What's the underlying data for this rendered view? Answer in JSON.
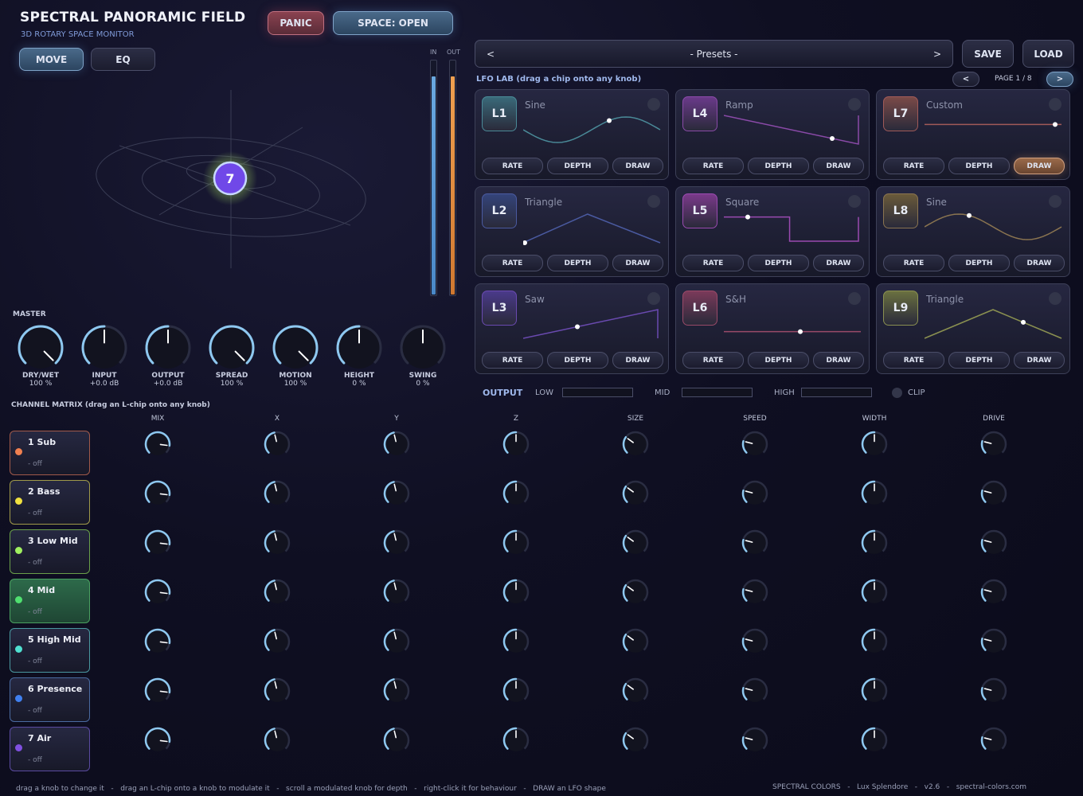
{
  "header": {
    "title": "SPECTRAL PANORAMIC FIELD",
    "subtitle": "3D ROTARY SPACE MONITOR",
    "panic_label": "PANIC",
    "space_label": "SPACE:  OPEN",
    "move_label": "MOVE",
    "eq_label": "EQ"
  },
  "monitor": {
    "source_number": "7"
  },
  "meters": {
    "in_label": "IN",
    "out_label": "OUT",
    "in_level": 0.93,
    "out_level": 0.93
  },
  "presets": {
    "prev": "<",
    "name": "- Presets -",
    "next": ">",
    "save": "SAVE",
    "load": "LOAD"
  },
  "lfo_lab": {
    "title": "LFO LAB  (drag a chip onto any knob)",
    "page": "PAGE 1 / 8",
    "page_prev": "<",
    "page_next": ">",
    "rate_label": "RATE",
    "depth_label": "DEPTH",
    "draw_label": "DRAW",
    "cards": [
      {
        "id": "L1",
        "shape": "Sine"
      },
      {
        "id": "L2",
        "shape": "Triangle"
      },
      {
        "id": "L3",
        "shape": "Saw"
      },
      {
        "id": "L4",
        "shape": "Ramp"
      },
      {
        "id": "L5",
        "shape": "Square"
      },
      {
        "id": "L6",
        "shape": "S&H"
      },
      {
        "id": "L7",
        "shape": "Custom"
      },
      {
        "id": "L8",
        "shape": "Sine"
      },
      {
        "id": "L9",
        "shape": "Triangle"
      }
    ]
  },
  "master": {
    "title": "MASTER",
    "knobs": [
      {
        "label": "DRY/WET",
        "value": "100 %"
      },
      {
        "label": "INPUT",
        "value": "+0.0 dB"
      },
      {
        "label": "OUTPUT",
        "value": "+0.0 dB"
      },
      {
        "label": "SPREAD",
        "value": "100 %"
      },
      {
        "label": "MOTION",
        "value": "100 %"
      },
      {
        "label": "HEIGHT",
        "value": "0 %"
      },
      {
        "label": "SWING",
        "value": "0 %"
      }
    ]
  },
  "output": {
    "label": "OUTPUT",
    "low": "LOW",
    "mid": "MID",
    "high": "HIGH",
    "clip": "CLIP"
  },
  "matrix": {
    "title": "CHANNEL MATRIX  (drag an L-chip onto any knob)",
    "columns": [
      "MIX",
      "X",
      "Y",
      "Z",
      "SIZE",
      "SPEED",
      "WIDTH",
      "DRIVE"
    ],
    "channels": [
      {
        "name": "1 Sub",
        "status": "- off",
        "color": "#f08050"
      },
      {
        "name": "2 Bass",
        "status": "- off",
        "color": "#f0e040"
      },
      {
        "name": "3 Low Mid",
        "status": "- off",
        "color": "#a0f060"
      },
      {
        "name": "4 Mid",
        "status": "- off",
        "color": "#50e070"
      },
      {
        "name": "5 High Mid",
        "status": "- off",
        "color": "#50e0d0"
      },
      {
        "name": "6 Presence",
        "status": "- off",
        "color": "#4080f0"
      },
      {
        "name": "7 Air",
        "status": "- off",
        "color": "#8050e0"
      }
    ]
  },
  "footer": {
    "help": "drag a knob to change it   -   drag an L-chip onto a knob to modulate it   -   scroll a modulated knob for depth   -   right-click it for behaviour   -   DRAW an LFO shape",
    "brand": "SPECTRAL COLORS   -   Lux Splendore   -   v2.6   -   spectral-colors.com"
  },
  "colors": {
    "accent": "#8ec8f0",
    "chip_l1": "#3a6a7a",
    "chip_l2": "#34447a",
    "chip_l3": "#4a3a8a",
    "chip_l4": "#6a3a8a",
    "chip_l5": "#7a3a8a",
    "chip_l6": "#7a3a5a",
    "chip_l7": "#7a4a48",
    "chip_l8": "#6a5a3a",
    "chip_l9": "#6a7040"
  }
}
